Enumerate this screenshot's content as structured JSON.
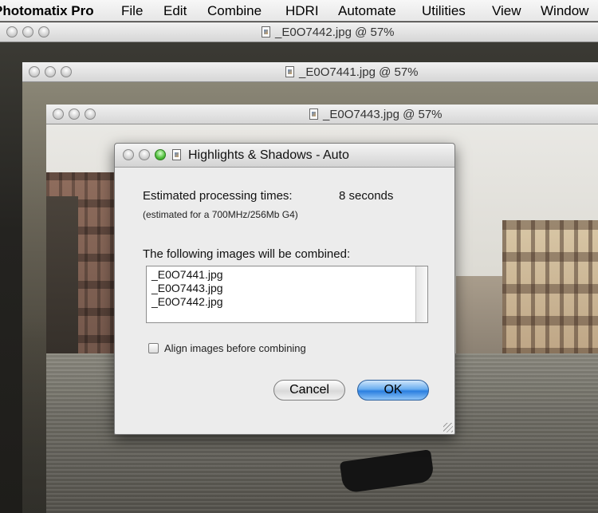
{
  "menubar": {
    "app_name": "Photomatix Pro",
    "items": [
      "File",
      "Edit",
      "Combine",
      "HDRI",
      "Automate",
      "Utilities",
      "View",
      "Window"
    ]
  },
  "windows": [
    {
      "title": "_E0O7442.jpg @ 57%"
    },
    {
      "title": "_E0O7441.jpg @ 57%"
    },
    {
      "title": "_E0O7443.jpg @ 57%"
    }
  ],
  "dialog": {
    "title": "Highlights & Shadows - Auto",
    "processing_label": "Estimated processing times:",
    "processing_value": "8 seconds",
    "processing_note": "(estimated for a 700MHz/256Mb G4)",
    "list_label": "The following images will be combined:",
    "images": [
      "_E0O7441.jpg",
      "_E0O7443.jpg",
      "_E0O7442.jpg"
    ],
    "align_checkbox_label": "Align images before combining",
    "align_checked": false,
    "cancel_label": "Cancel",
    "ok_label": "OK"
  },
  "colors": {
    "ok_button": "#3b8ae6",
    "dialog_bg": "#ececec",
    "green_light": "#4fbf3a"
  }
}
